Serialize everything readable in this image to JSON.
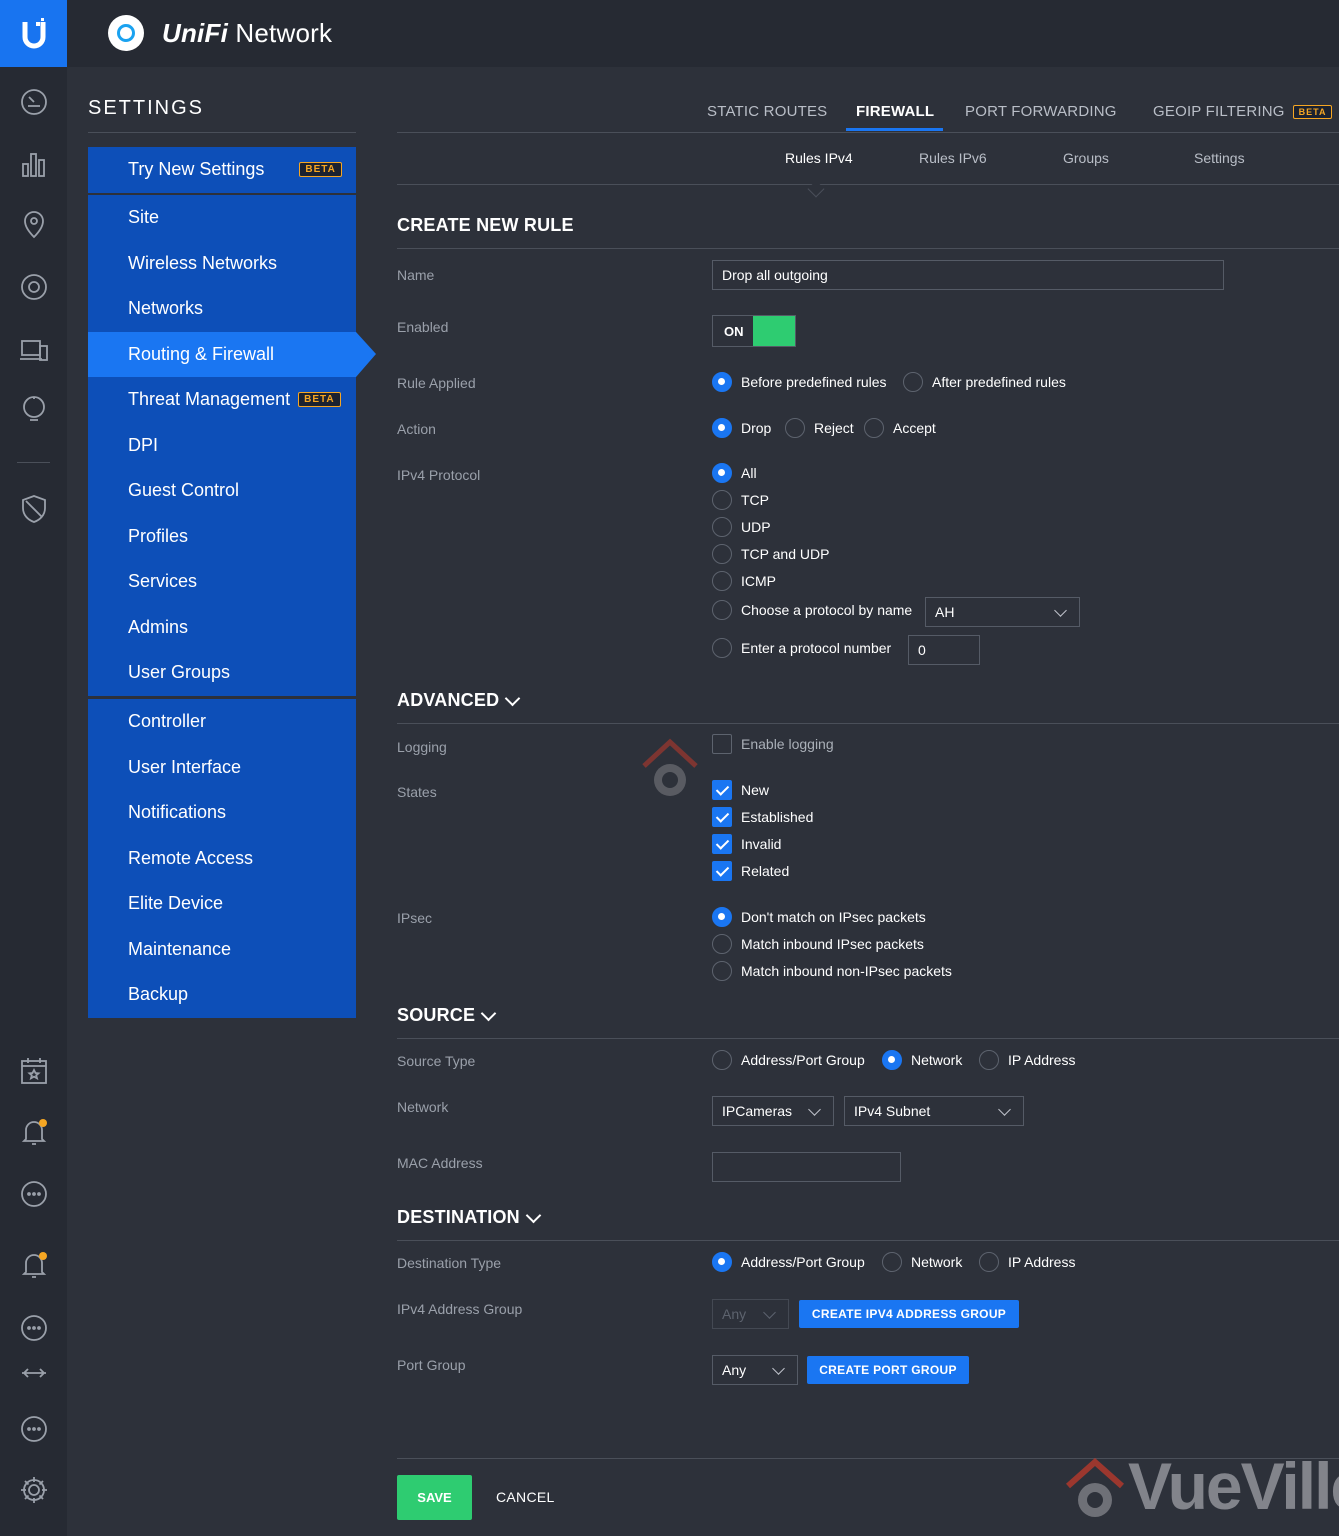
{
  "app": {
    "brand_bold": "UniFi",
    "brand_rest": " Network"
  },
  "sidebar": {
    "title": "SETTINGS",
    "try_new": {
      "label": "Try New Settings",
      "badge": "BETA"
    },
    "group1": [
      "Site",
      "Wireless Networks",
      "Networks",
      "Routing & Firewall",
      "Threat Management",
      "DPI",
      "Guest Control",
      "Profiles",
      "Services",
      "Admins",
      "User Groups"
    ],
    "threat_badge": "BETA",
    "group2": [
      "Controller",
      "User Interface",
      "Notifications",
      "Remote Access",
      "Elite Device",
      "Maintenance",
      "Backup"
    ]
  },
  "tabs": {
    "static_routes": "STATIC ROUTES",
    "firewall": "FIREWALL",
    "port_forwarding": "PORT FORWARDING",
    "geoip": "GEOIP FILTERING",
    "geoip_badge": "BETA"
  },
  "subtabs": {
    "rules_ipv4": "Rules IPv4",
    "rules_ipv6": "Rules IPv6",
    "groups": "Groups",
    "settings": "Settings"
  },
  "create": {
    "heading": "CREATE NEW RULE",
    "name_label": "Name",
    "name_value": "Drop all outgoing",
    "enabled_label": "Enabled",
    "enabled_value": "ON",
    "rule_applied_label": "Rule Applied",
    "before": "Before predefined rules",
    "after": "After predefined rules",
    "action_label": "Action",
    "drop": "Drop",
    "reject": "Reject",
    "accept": "Accept",
    "protocol_label": "IPv4 Protocol",
    "p_all": "All",
    "p_tcp": "TCP",
    "p_udp": "UDP",
    "p_tcpudp": "TCP and UDP",
    "p_icmp": "ICMP",
    "p_byname": "Choose a protocol by name",
    "p_byname_value": "AH",
    "p_bynumber": "Enter a protocol number",
    "p_bynumber_value": "0"
  },
  "advanced": {
    "heading": "ADVANCED",
    "logging_label": "Logging",
    "logging_opt": "Enable logging",
    "states_label": "States",
    "s_new": "New",
    "s_established": "Established",
    "s_invalid": "Invalid",
    "s_related": "Related",
    "ipsec_label": "IPsec",
    "ipsec_none": "Don't match on IPsec packets",
    "ipsec_in": "Match inbound IPsec packets",
    "ipsec_non": "Match inbound non-IPsec packets"
  },
  "source": {
    "heading": "SOURCE",
    "type_label": "Source Type",
    "t_group": "Address/Port Group",
    "t_network": "Network",
    "t_ip": "IP Address",
    "network_label": "Network",
    "network_value": "IPCameras",
    "subnet_value": "IPv4 Subnet",
    "mac_label": "MAC Address",
    "mac_value": ""
  },
  "destination": {
    "heading": "DESTINATION",
    "type_label": "Destination Type",
    "t_group": "Address/Port Group",
    "t_network": "Network",
    "t_ip": "IP Address",
    "addr_group_label": "IPv4 Address Group",
    "addr_group_value": "Any",
    "create_addr_group": "CREATE IPV4 ADDRESS GROUP",
    "port_group_label": "Port Group",
    "port_group_value": "Any",
    "create_port_group": "CREATE PORT GROUP"
  },
  "actions": {
    "save": "SAVE",
    "cancel": "CANCEL"
  },
  "watermark": "VueVille",
  "colors": {
    "accent": "#1a76f2",
    "sidebar": "#0d4fb8",
    "success": "#2ecc71",
    "beta": "#f5a623"
  }
}
